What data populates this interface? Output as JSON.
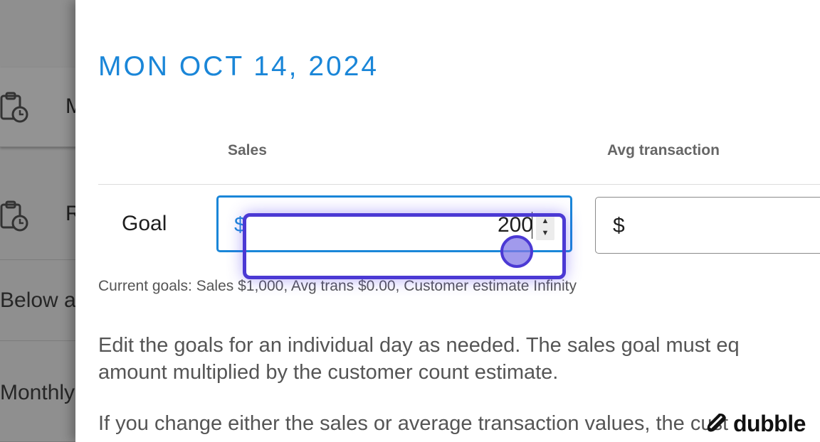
{
  "background": {
    "rows": [
      {
        "icon": "clipboard-clock-icon",
        "letter": "M"
      },
      {
        "icon": "clipboard-clock-icon",
        "letter": "R"
      }
    ],
    "text_below": "Below a",
    "text_monthly": "Monthly"
  },
  "drawer": {
    "date_title": "MON OCT 14, 2024",
    "columns": {
      "sales": "Sales",
      "avg_transaction": "Avg transaction"
    },
    "goal_row": {
      "label": "Goal",
      "sales_prefix": "$",
      "sales_value": "200",
      "avg_prefix": "$",
      "avg_value": ""
    },
    "helper_text": "Current goals: Sales $1,000, Avg trans $0.00, Customer estimate Infinity",
    "paragraph_1_line_1": "Edit the goals for an individual day as needed. The sales goal must eq",
    "paragraph_1_line_2": "amount multiplied by the customer count estimate.",
    "paragraph_2_line_1": "If you change either the sales or average transaction values, the cust"
  },
  "watermark": {
    "brand": "dubble"
  },
  "colors": {
    "accent": "#1a86d8",
    "highlight": "#4b39d4",
    "overlay": "#8f8f8f"
  }
}
